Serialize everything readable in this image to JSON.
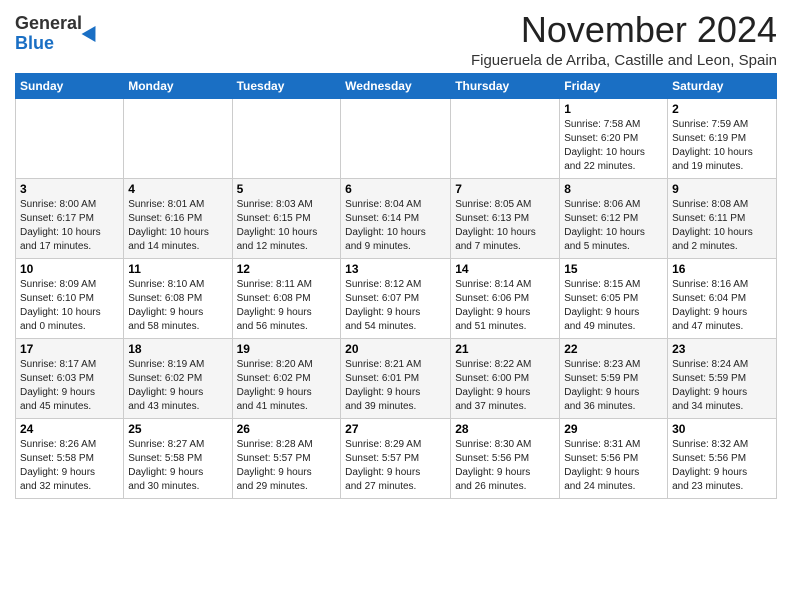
{
  "header": {
    "logo_line1": "General",
    "logo_line2": "Blue",
    "month": "November 2024",
    "location": "Figueruela de Arriba, Castille and Leon, Spain"
  },
  "weekdays": [
    "Sunday",
    "Monday",
    "Tuesday",
    "Wednesday",
    "Thursday",
    "Friday",
    "Saturday"
  ],
  "weeks": [
    [
      {
        "day": "",
        "info": ""
      },
      {
        "day": "",
        "info": ""
      },
      {
        "day": "",
        "info": ""
      },
      {
        "day": "",
        "info": ""
      },
      {
        "day": "",
        "info": ""
      },
      {
        "day": "1",
        "info": "Sunrise: 7:58 AM\nSunset: 6:20 PM\nDaylight: 10 hours\nand 22 minutes."
      },
      {
        "day": "2",
        "info": "Sunrise: 7:59 AM\nSunset: 6:19 PM\nDaylight: 10 hours\nand 19 minutes."
      }
    ],
    [
      {
        "day": "3",
        "info": "Sunrise: 8:00 AM\nSunset: 6:17 PM\nDaylight: 10 hours\nand 17 minutes."
      },
      {
        "day": "4",
        "info": "Sunrise: 8:01 AM\nSunset: 6:16 PM\nDaylight: 10 hours\nand 14 minutes."
      },
      {
        "day": "5",
        "info": "Sunrise: 8:03 AM\nSunset: 6:15 PM\nDaylight: 10 hours\nand 12 minutes."
      },
      {
        "day": "6",
        "info": "Sunrise: 8:04 AM\nSunset: 6:14 PM\nDaylight: 10 hours\nand 9 minutes."
      },
      {
        "day": "7",
        "info": "Sunrise: 8:05 AM\nSunset: 6:13 PM\nDaylight: 10 hours\nand 7 minutes."
      },
      {
        "day": "8",
        "info": "Sunrise: 8:06 AM\nSunset: 6:12 PM\nDaylight: 10 hours\nand 5 minutes."
      },
      {
        "day": "9",
        "info": "Sunrise: 8:08 AM\nSunset: 6:11 PM\nDaylight: 10 hours\nand 2 minutes."
      }
    ],
    [
      {
        "day": "10",
        "info": "Sunrise: 8:09 AM\nSunset: 6:10 PM\nDaylight: 10 hours\nand 0 minutes."
      },
      {
        "day": "11",
        "info": "Sunrise: 8:10 AM\nSunset: 6:08 PM\nDaylight: 9 hours\nand 58 minutes."
      },
      {
        "day": "12",
        "info": "Sunrise: 8:11 AM\nSunset: 6:08 PM\nDaylight: 9 hours\nand 56 minutes."
      },
      {
        "day": "13",
        "info": "Sunrise: 8:12 AM\nSunset: 6:07 PM\nDaylight: 9 hours\nand 54 minutes."
      },
      {
        "day": "14",
        "info": "Sunrise: 8:14 AM\nSunset: 6:06 PM\nDaylight: 9 hours\nand 51 minutes."
      },
      {
        "day": "15",
        "info": "Sunrise: 8:15 AM\nSunset: 6:05 PM\nDaylight: 9 hours\nand 49 minutes."
      },
      {
        "day": "16",
        "info": "Sunrise: 8:16 AM\nSunset: 6:04 PM\nDaylight: 9 hours\nand 47 minutes."
      }
    ],
    [
      {
        "day": "17",
        "info": "Sunrise: 8:17 AM\nSunset: 6:03 PM\nDaylight: 9 hours\nand 45 minutes."
      },
      {
        "day": "18",
        "info": "Sunrise: 8:19 AM\nSunset: 6:02 PM\nDaylight: 9 hours\nand 43 minutes."
      },
      {
        "day": "19",
        "info": "Sunrise: 8:20 AM\nSunset: 6:02 PM\nDaylight: 9 hours\nand 41 minutes."
      },
      {
        "day": "20",
        "info": "Sunrise: 8:21 AM\nSunset: 6:01 PM\nDaylight: 9 hours\nand 39 minutes."
      },
      {
        "day": "21",
        "info": "Sunrise: 8:22 AM\nSunset: 6:00 PM\nDaylight: 9 hours\nand 37 minutes."
      },
      {
        "day": "22",
        "info": "Sunrise: 8:23 AM\nSunset: 5:59 PM\nDaylight: 9 hours\nand 36 minutes."
      },
      {
        "day": "23",
        "info": "Sunrise: 8:24 AM\nSunset: 5:59 PM\nDaylight: 9 hours\nand 34 minutes."
      }
    ],
    [
      {
        "day": "24",
        "info": "Sunrise: 8:26 AM\nSunset: 5:58 PM\nDaylight: 9 hours\nand 32 minutes."
      },
      {
        "day": "25",
        "info": "Sunrise: 8:27 AM\nSunset: 5:58 PM\nDaylight: 9 hours\nand 30 minutes."
      },
      {
        "day": "26",
        "info": "Sunrise: 8:28 AM\nSunset: 5:57 PM\nDaylight: 9 hours\nand 29 minutes."
      },
      {
        "day": "27",
        "info": "Sunrise: 8:29 AM\nSunset: 5:57 PM\nDaylight: 9 hours\nand 27 minutes."
      },
      {
        "day": "28",
        "info": "Sunrise: 8:30 AM\nSunset: 5:56 PM\nDaylight: 9 hours\nand 26 minutes."
      },
      {
        "day": "29",
        "info": "Sunrise: 8:31 AM\nSunset: 5:56 PM\nDaylight: 9 hours\nand 24 minutes."
      },
      {
        "day": "30",
        "info": "Sunrise: 8:32 AM\nSunset: 5:56 PM\nDaylight: 9 hours\nand 23 minutes."
      }
    ]
  ]
}
